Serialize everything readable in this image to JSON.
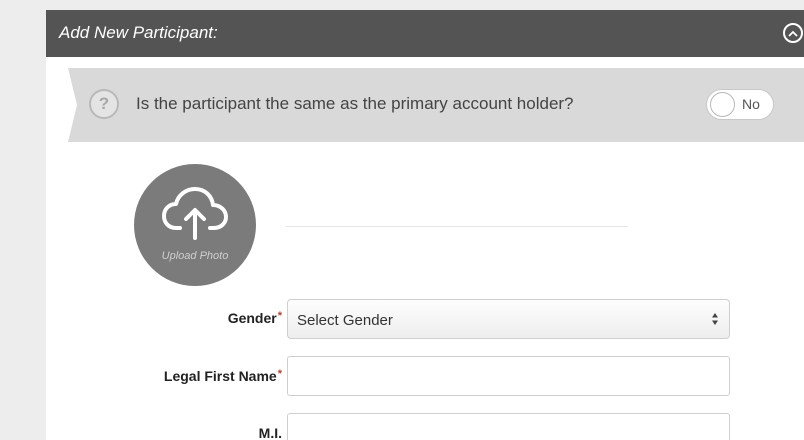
{
  "panel": {
    "title": "Add New Participant:"
  },
  "question": {
    "help_symbol": "?",
    "text": "Is the participant the same as the primary account holder?",
    "toggle_label": "No",
    "toggle_on": false
  },
  "upload": {
    "label": "Upload Photo",
    "icon": "cloud-upload-icon"
  },
  "form": {
    "gender": {
      "label": "Gender",
      "required_mark": "*",
      "selected": "Select Gender"
    },
    "first_name": {
      "label": "Legal First Name",
      "required_mark": "*",
      "value": ""
    },
    "mi": {
      "label": "M.I.",
      "value": ""
    }
  },
  "colors": {
    "header_bg": "#545454",
    "question_bg": "#d9d9d9",
    "required": "#c0392b",
    "upload_bg": "#7b7b7b",
    "page_bg": "#ededed"
  }
}
